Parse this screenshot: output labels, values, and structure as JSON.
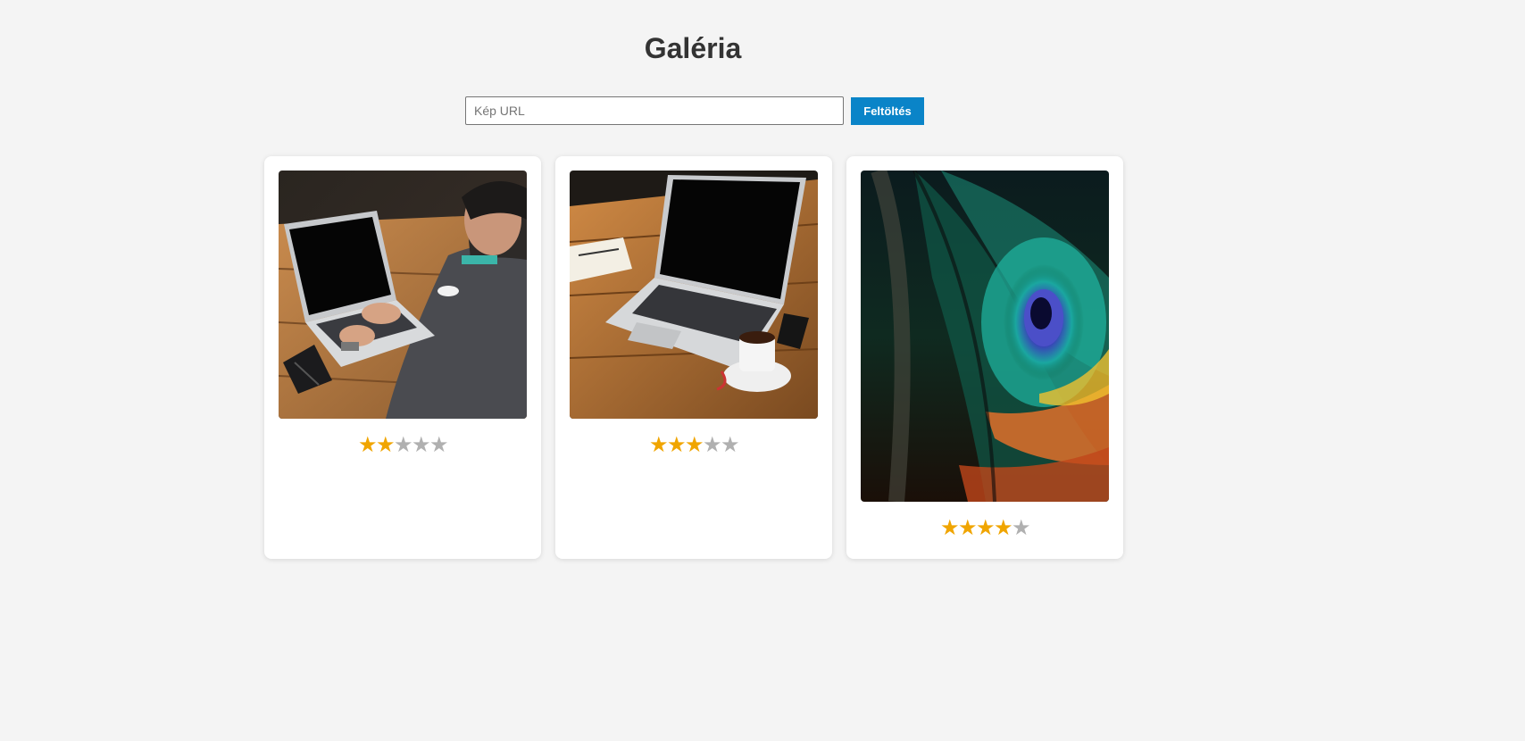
{
  "header": {
    "title": "Galéria"
  },
  "upload": {
    "url_placeholder": "Kép URL",
    "url_value": "",
    "button_label": "Feltöltés"
  },
  "colors": {
    "accent": "#0a84c8",
    "star_on": "#f0a500",
    "star_off": "#b0b0b0",
    "background": "#f4f4f4"
  },
  "gallery": {
    "images": [
      {
        "subject": "person typing on laptop at wooden table",
        "rating": 2,
        "max_rating": 5
      },
      {
        "subject": "open laptop with notebook and coffee cup on wooden table",
        "rating": 3,
        "max_rating": 5
      },
      {
        "subject": "peacock feather close-up",
        "rating": 4,
        "max_rating": 5
      }
    ]
  }
}
